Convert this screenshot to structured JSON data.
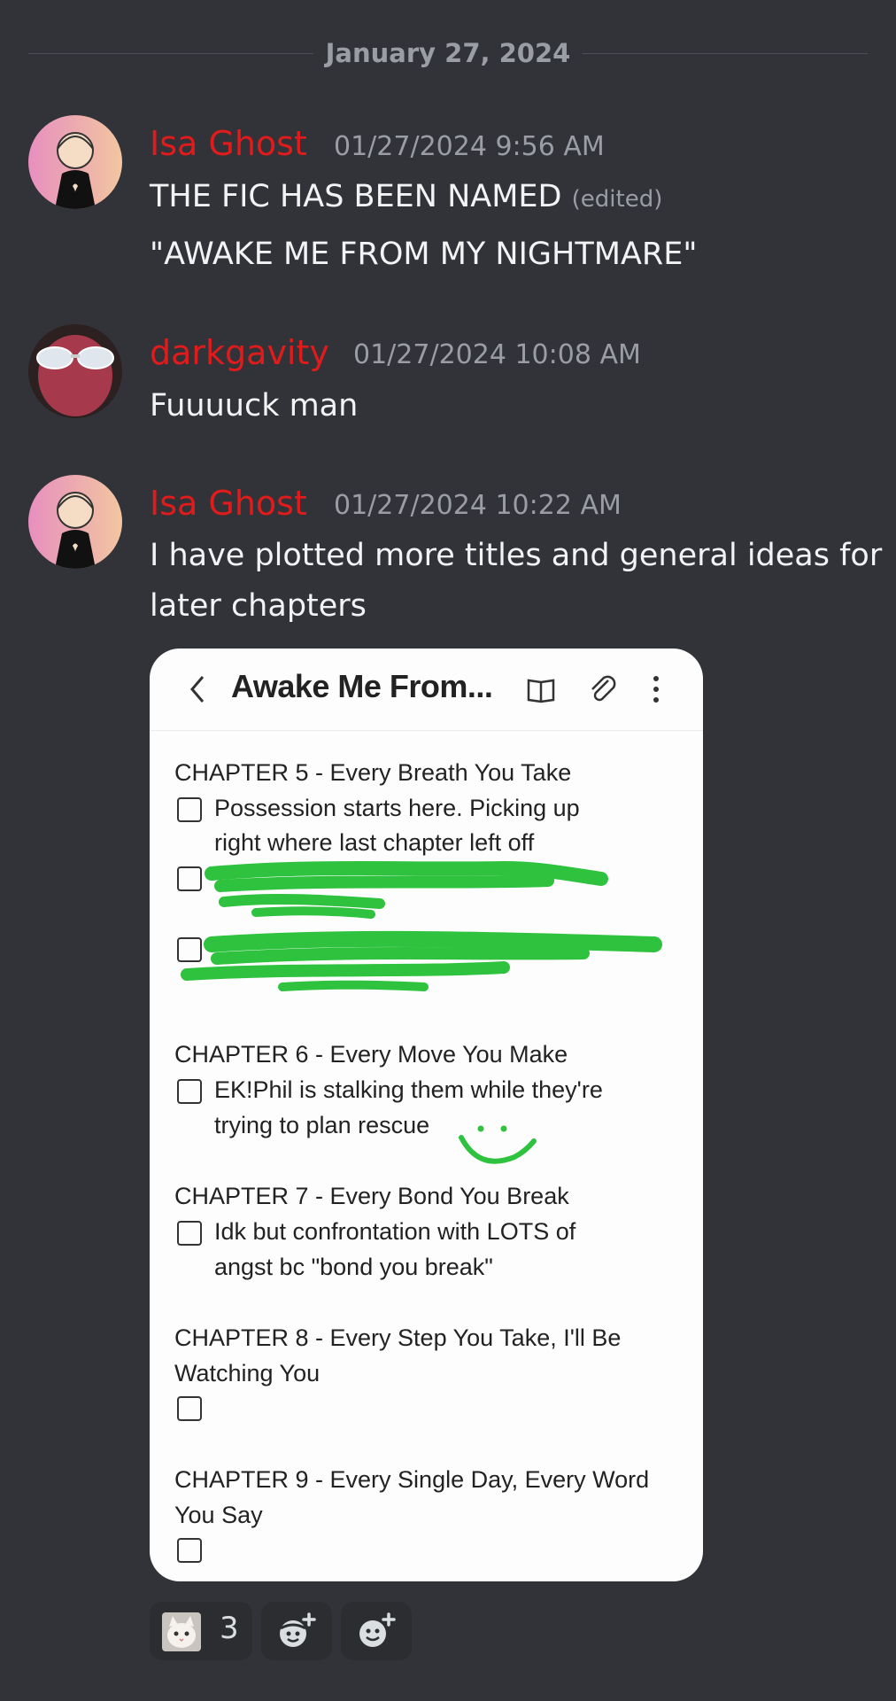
{
  "date_divider": "January 27, 2024",
  "messages": [
    {
      "author": "Isa Ghost",
      "timestamp": "01/27/2024 9:56 AM",
      "lines": [
        "THE FIC HAS BEEN NAMED",
        "\"AWAKE ME FROM MY NIGHTMARE\""
      ],
      "edited_label": "(edited)"
    },
    {
      "author": "darkgavity",
      "timestamp": "01/27/2024 10:08 AM",
      "lines": [
        "Fuuuuck man"
      ]
    },
    {
      "author": "Isa Ghost",
      "timestamp": "01/27/2024 10:22 AM",
      "lines": [
        "I have plotted more titles and general ideas for",
        "later chapters"
      ]
    }
  ],
  "attachment": {
    "note_title": "Awake Me From...",
    "chapters": [
      {
        "heading": "CHAPTER 5 - Every Breath You Take",
        "items": [
          "Possession starts here. Picking up",
          "right where last chapter left off"
        ]
      },
      {
        "heading": "CHAPTER 6 - Every Move You Make",
        "items": [
          "EK!Phil is stalking them while they're",
          "trying to plan rescue"
        ]
      },
      {
        "heading": "CHAPTER 7 - Every Bond You Break",
        "items": [
          "Idk but confrontation with LOTS of",
          "angst bc \"bond you break\""
        ]
      },
      {
        "heading_lines": [
          "CHAPTER 8 - Every Step You Take, I'll Be",
          "Watching You"
        ]
      },
      {
        "heading_lines": [
          "CHAPTER 9 - Every Single Day, Every Word",
          "You Say"
        ]
      }
    ]
  },
  "reactions": [
    {
      "emoji": "cat-emoji",
      "count": "3"
    },
    {
      "emoji": "add-reaction-icon"
    },
    {
      "emoji": "add-super-reaction-icon"
    }
  ],
  "colors": {
    "background": "#313338",
    "username": "#e01b1b",
    "timestamp": "#9a9da4",
    "scribble": "#2ec23e"
  }
}
